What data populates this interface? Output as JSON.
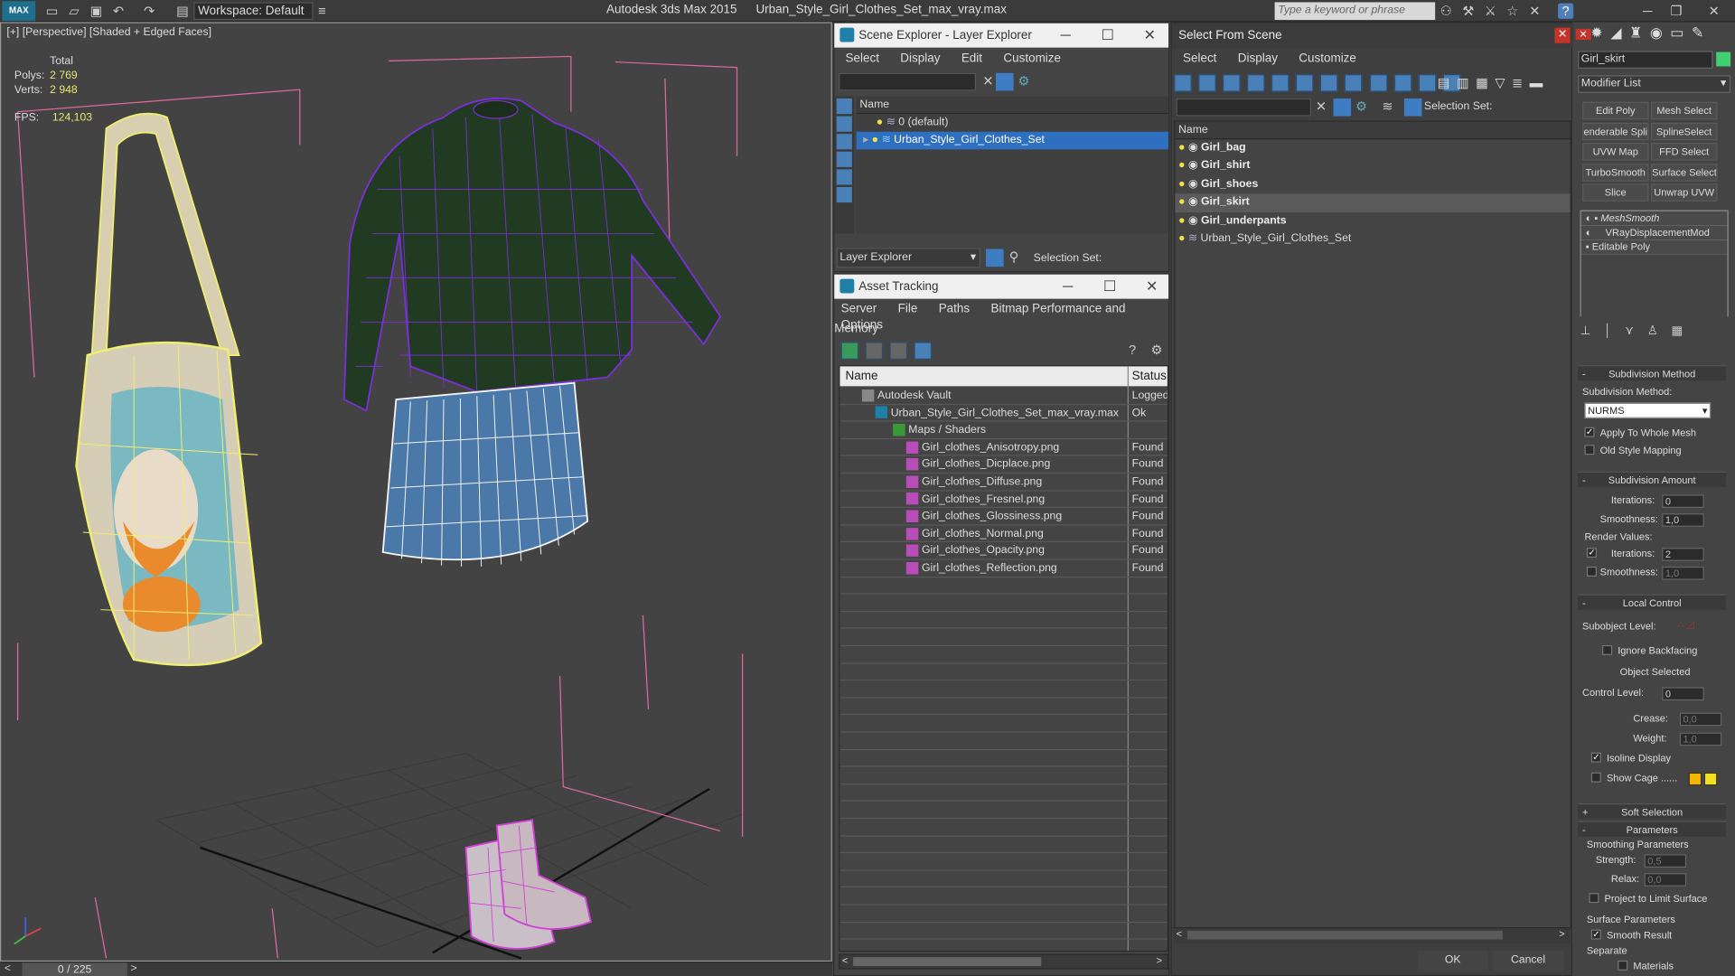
{
  "titlebar": {
    "logo": "MAX",
    "workspace": "Workspace: Default",
    "app_title": "Autodesk 3ds Max  2015",
    "file_name": "Urban_Style_Girl_Clothes_Set_max_vray.max",
    "search_placeholder": "Type a keyword or phrase"
  },
  "viewport": {
    "label": "[+] [Perspective] [Shaded + Edged Faces]",
    "stats_total": "Total",
    "polys_label": "Polys:",
    "polys_value": "2 769",
    "verts_label": "Verts:",
    "verts_value": "2 948",
    "fps_label": "FPS:",
    "fps_value": "124,103",
    "frame": "0 / 225"
  },
  "scene_explorer": {
    "title": "Scene Explorer - Layer Explorer",
    "menu": [
      "Select",
      "Display",
      "Edit",
      "Customize"
    ],
    "column": "Name",
    "layers": [
      "0 (default)",
      "Urban_Style_Girl_Clothes_Set"
    ],
    "footer_dropdown": "Layer Explorer",
    "selection_set": "Selection Set:"
  },
  "asset_tracking": {
    "title": "Asset Tracking",
    "menu": [
      "Server",
      "File",
      "Paths",
      "Bitmap Performance and Memory"
    ],
    "menu2": "Options",
    "col_name": "Name",
    "col_status": "Status",
    "rows": [
      {
        "name": "Autodesk Vault",
        "status": "Logged",
        "indent": 0
      },
      {
        "name": "Urban_Style_Girl_Clothes_Set_max_vray.max",
        "status": "Ok",
        "indent": 1
      },
      {
        "name": "Maps / Shaders",
        "status": "",
        "indent": 2
      },
      {
        "name": "Girl_clothes_Anisotropy.png",
        "status": "Found",
        "indent": 3
      },
      {
        "name": "Girl_clothes_Dicplace.png",
        "status": "Found",
        "indent": 3
      },
      {
        "name": "Girl_clothes_Diffuse.png",
        "status": "Found",
        "indent": 3
      },
      {
        "name": "Girl_clothes_Fresnel.png",
        "status": "Found",
        "indent": 3
      },
      {
        "name": "Girl_clothes_Glossiness.png",
        "status": "Found",
        "indent": 3
      },
      {
        "name": "Girl_clothes_Normal.png",
        "status": "Found",
        "indent": 3
      },
      {
        "name": "Girl_clothes_Opacity.png",
        "status": "Found",
        "indent": 3
      },
      {
        "name": "Girl_clothes_Reflection.png",
        "status": "Found",
        "indent": 3
      }
    ]
  },
  "select_from_scene": {
    "title": "Select From Scene",
    "menu": [
      "Select",
      "Display",
      "Customize"
    ],
    "selection_set": "Selection Set:",
    "column": "Name",
    "objects": [
      "Girl_bag",
      "Girl_shirt",
      "Girl_shoes",
      "Girl_skirt",
      "Girl_underpants",
      "Urban_Style_Girl_Clothes_Set"
    ],
    "ok": "OK",
    "cancel": "Cancel"
  },
  "command_panel": {
    "object_name": "Girl_skirt",
    "modifier_list": "Modifier List",
    "buttons": [
      "Edit Poly",
      "Mesh Select",
      "enderable Spli",
      "SplineSelect",
      "UVW Map",
      "FFD Select",
      "TurboSmooth",
      "Surface Select",
      "Slice",
      "Unwrap UVW"
    ],
    "stack": [
      "MeshSmooth",
      "VRayDisplacementMod",
      "Editable Poly"
    ],
    "subdivision_method_title": "Subdivision Method",
    "subdivision_method_label": "Subdivision Method:",
    "subdivision_method_value": "NURMS",
    "apply_whole_mesh": "Apply To Whole Mesh",
    "old_style_mapping": "Old Style Mapping",
    "subdivision_amount_title": "Subdivision Amount",
    "iterations_label": "Iterations:",
    "iterations_value": "0",
    "smoothness_label": "Smoothness:",
    "smoothness_value": "1,0",
    "render_values": "Render Values:",
    "render_iterations_value": "2",
    "render_smoothness_value": "1,0",
    "local_control_title": "Local Control",
    "subobject_level": "Subobject Level:",
    "ignore_backfacing": "Ignore Backfacing",
    "object_selected": "Object Selected",
    "control_level_label": "Control Level:",
    "control_level_value": "0",
    "crease_label": "Crease:",
    "crease_value": "0,0",
    "weight_label": "Weight:",
    "weight_value": "1,0",
    "isoline_display": "Isoline Display",
    "show_cage": "Show Cage ......",
    "cage_color_1": "#f2b600",
    "cage_color_2": "#f0e020",
    "soft_selection_title": "Soft Selection",
    "parameters_title": "Parameters",
    "smoothing_parameters": "Smoothing Parameters",
    "strength_label": "Strength:",
    "strength_value": "0,5",
    "relax_label": "Relax:",
    "relax_value": "0,0",
    "project_limit": "Project to Limit Surface",
    "surface_parameters": "Surface Parameters",
    "smooth_result": "Smooth Result",
    "separate": "Separate",
    "materials": "Materials"
  }
}
